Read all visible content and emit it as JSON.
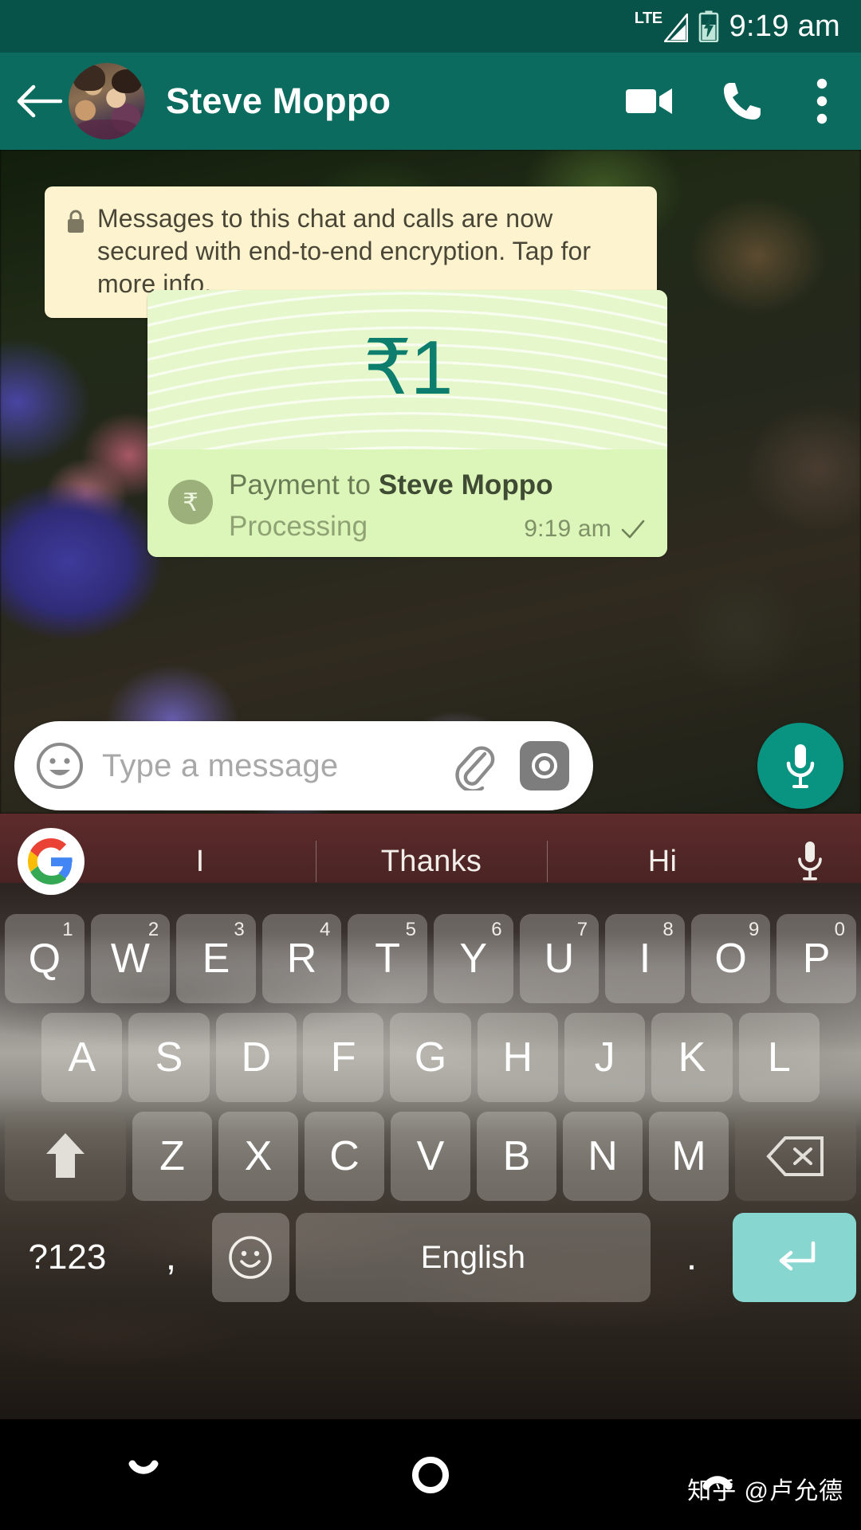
{
  "statusbar": {
    "network_label": "LTE",
    "time": "9:19 am",
    "signal_icon": "signal-triangle-icon",
    "battery_icon": "battery-charging-icon"
  },
  "appbar": {
    "back_icon": "back-arrow-icon",
    "avatar": "contact-avatar",
    "contact_name": "Steve Moppo",
    "video_icon": "video-call-icon",
    "call_icon": "voice-call-icon",
    "more_icon": "overflow-menu-icon"
  },
  "chat": {
    "encryption_notice": {
      "lock_icon": "lock-icon",
      "text": "Messages to this chat and calls are now secured with end-to-end encryption. Tap for more info."
    },
    "payment_message": {
      "currency_symbol": "₹",
      "amount": "1",
      "amount_display": "₹1",
      "badge_icon": "rupee-badge-icon",
      "badge_symbol": "₹",
      "title_prefix": "Payment to ",
      "recipient": "Steve Moppo",
      "status": "Processing",
      "time": "9:19 am",
      "delivery_icon": "single-check-icon",
      "bubble_color": "#dcf5b9",
      "amount_color": "#0d7d6e"
    }
  },
  "input_bar": {
    "emoji_icon": "emoji-icon",
    "placeholder": "Type a message",
    "attach_icon": "paperclip-icon",
    "camera_icon": "camera-icon",
    "mic_icon": "microphone-icon",
    "mic_color": "#089480"
  },
  "keyboard": {
    "google_logo": "google-logo-icon",
    "suggestions": [
      "I",
      "Thanks",
      "Hi"
    ],
    "voice_icon": "keyboard-mic-icon",
    "row1": [
      {
        "letter": "Q",
        "num": "1"
      },
      {
        "letter": "W",
        "num": "2"
      },
      {
        "letter": "E",
        "num": "3"
      },
      {
        "letter": "R",
        "num": "4"
      },
      {
        "letter": "T",
        "num": "5"
      },
      {
        "letter": "Y",
        "num": "6"
      },
      {
        "letter": "U",
        "num": "7"
      },
      {
        "letter": "I",
        "num": "8"
      },
      {
        "letter": "O",
        "num": "9"
      },
      {
        "letter": "P",
        "num": "0"
      }
    ],
    "row2": [
      "A",
      "S",
      "D",
      "F",
      "G",
      "H",
      "J",
      "K",
      "L"
    ],
    "row3": {
      "shift_icon": "shift-icon",
      "letters": [
        "Z",
        "X",
        "C",
        "V",
        "B",
        "N",
        "M"
      ],
      "backspace_icon": "backspace-icon"
    },
    "row4": {
      "symbols_label": "?123",
      "comma_label": ",",
      "emoji_icon": "emoji-key-icon",
      "space_label": "English",
      "period_label": ".",
      "enter_icon": "enter-key-icon",
      "enter_color": "#87d6d0"
    }
  },
  "navbar": {
    "back_icon": "nav-back-icon",
    "home_icon": "nav-home-icon",
    "recents_icon": "nav-recents-icon"
  },
  "watermark": {
    "text": "知乎 @卢允德"
  }
}
